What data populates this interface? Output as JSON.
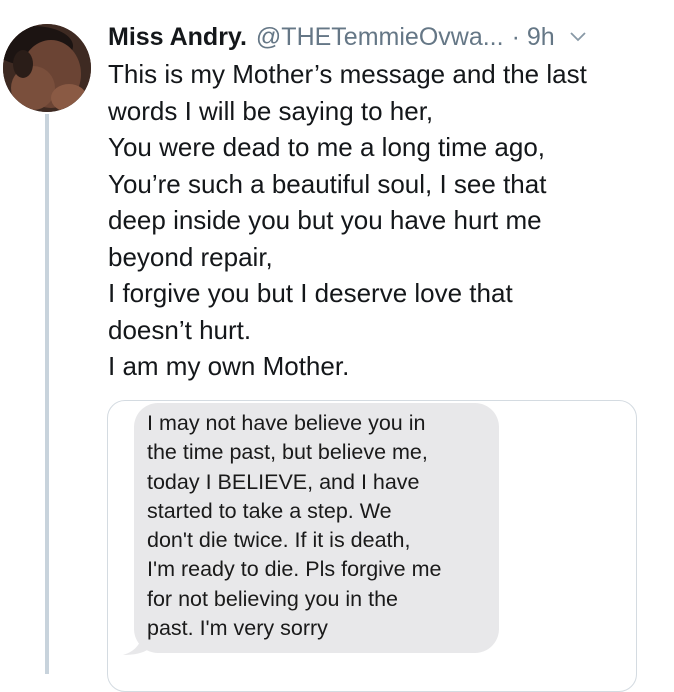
{
  "tweet": {
    "display_name": "Miss Andry.",
    "handle": "@THETemmieOvwa...",
    "time": "· 9h",
    "lines": [
      "This is my Mother’s message and the last",
      "words I will be saying to her,",
      "You were dead to me a long time ago,",
      "You’re such a beautiful soul, I see that",
      "deep inside you but you have hurt me",
      "beyond repair,",
      "I forgive you but I deserve love that",
      "doesn’t hurt.",
      "I am my own Mother."
    ]
  },
  "media": {
    "message_lines": [
      "I may not have believe you in",
      "the time past, but believe me,",
      "today I BELIEVE, and I have",
      "started to take a step. We",
      "don't die twice. If it is death,",
      "I'm ready to die. Pls forgive me",
      "for not believing you in the",
      "past. I'm very sorry"
    ]
  },
  "icons": {
    "avatar": "profile-photo",
    "caret": "chevron-down-icon"
  },
  "colors": {
    "text": "#14171a",
    "secondary_text": "#657786",
    "thread_line": "#c8d3dc",
    "card_border": "#d4dbe1",
    "bubble": "#e8e8ea"
  }
}
